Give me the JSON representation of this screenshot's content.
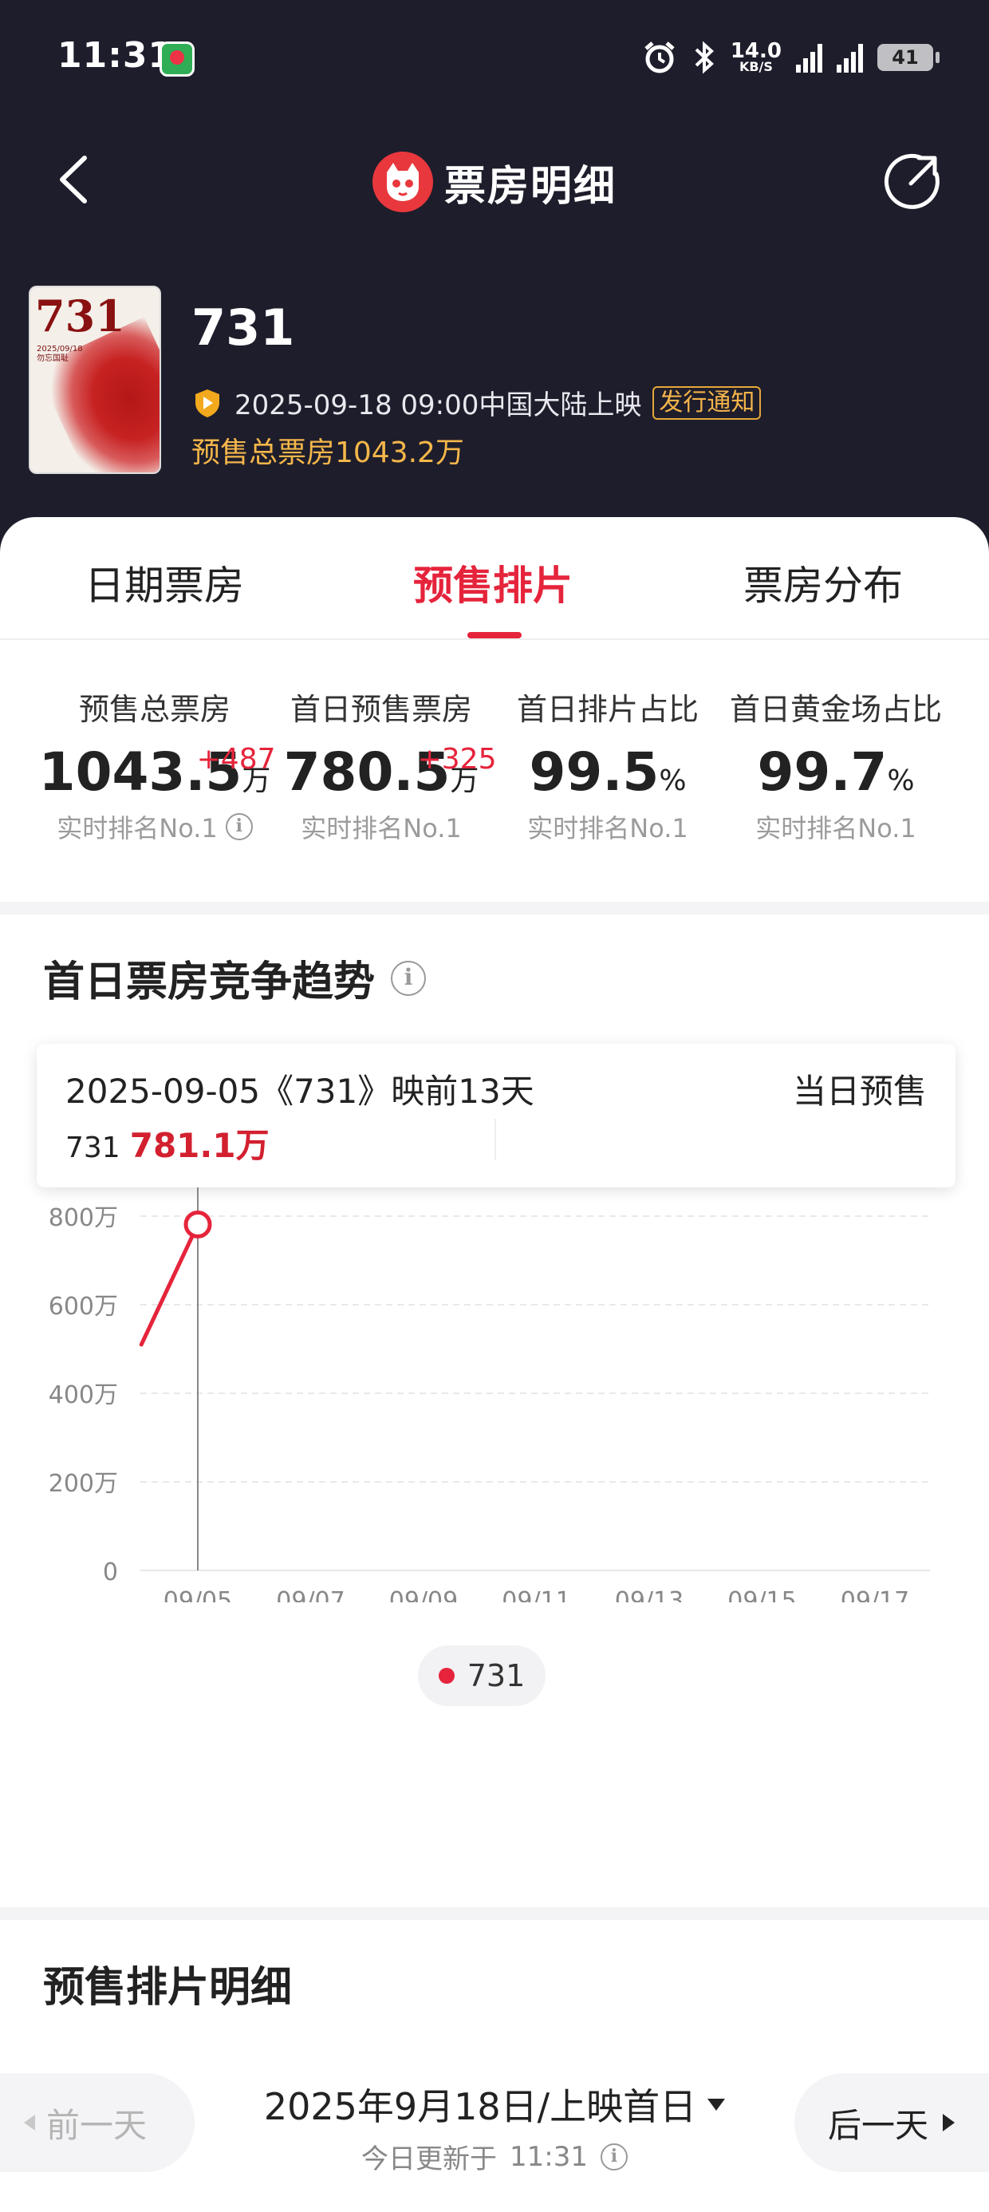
{
  "status_bar": {
    "time": "11:31",
    "net_speed": "14.0",
    "net_speed_unit": "KB/S",
    "battery": "41"
  },
  "nav": {
    "title": "票房明细",
    "logo_icon": "maoyan-cat-icon"
  },
  "movie": {
    "name": "731",
    "release_line": "2025-09-18 09:00中国大陆上映",
    "release_tag": "发行通知",
    "presale_total": "预售总票房1043.2万",
    "poster": {
      "title": "731",
      "sub_line1": "2025/09/18",
      "sub_line2": "勿忘国耻"
    }
  },
  "tabs": [
    {
      "label": "日期票房",
      "active": false
    },
    {
      "label": "预售排片",
      "active": true
    },
    {
      "label": "票房分布",
      "active": false
    }
  ],
  "stats": [
    {
      "label": "预售总票房",
      "value": "1043.5",
      "unit": "万",
      "increase": "+487",
      "rank": "实时排名No.1",
      "has_info": true
    },
    {
      "label": "首日预售票房",
      "value": "780.5",
      "unit": "万",
      "increase": "+325",
      "rank": "实时排名No.1",
      "has_info": false
    },
    {
      "label": "首日排片占比",
      "value": "99.5",
      "unit": "%",
      "increase": "",
      "rank": "实时排名No.1",
      "has_info": false
    },
    {
      "label": "首日黄金场占比",
      "value": "99.7",
      "unit": "%",
      "increase": "",
      "rank": "实时排名No.1",
      "has_info": false
    }
  ],
  "trend": {
    "title": "首日票房竞争趋势",
    "tooltip": {
      "date_line": "2025-09-05《731》映前13天",
      "right_label": "当日预售",
      "series_name": "731",
      "series_value": "781.1万"
    },
    "legend": "731"
  },
  "chart_data": {
    "type": "line",
    "x": [
      "09/04",
      "09/05"
    ],
    "series": [
      {
        "name": "731",
        "values": [
          510,
          781.1
        ],
        "color": "#e5243b"
      }
    ],
    "x_ticks": [
      "09/05",
      "09/07",
      "09/09",
      "09/11",
      "09/13",
      "09/15",
      "09/17"
    ],
    "y_ticks": [
      "0",
      "200万",
      "400万",
      "600万",
      "800万"
    ],
    "ylim": [
      0,
      800
    ],
    "highlight_x": "09/05",
    "grid": true,
    "legend_position": "bottom"
  },
  "detail": {
    "title": "预售排片明细",
    "prev_label": "前一天",
    "next_label": "后一天",
    "date_label": "2025年9月18日/上映首日",
    "updated_prefix": "今日更新于",
    "updated_time": "11:31"
  }
}
